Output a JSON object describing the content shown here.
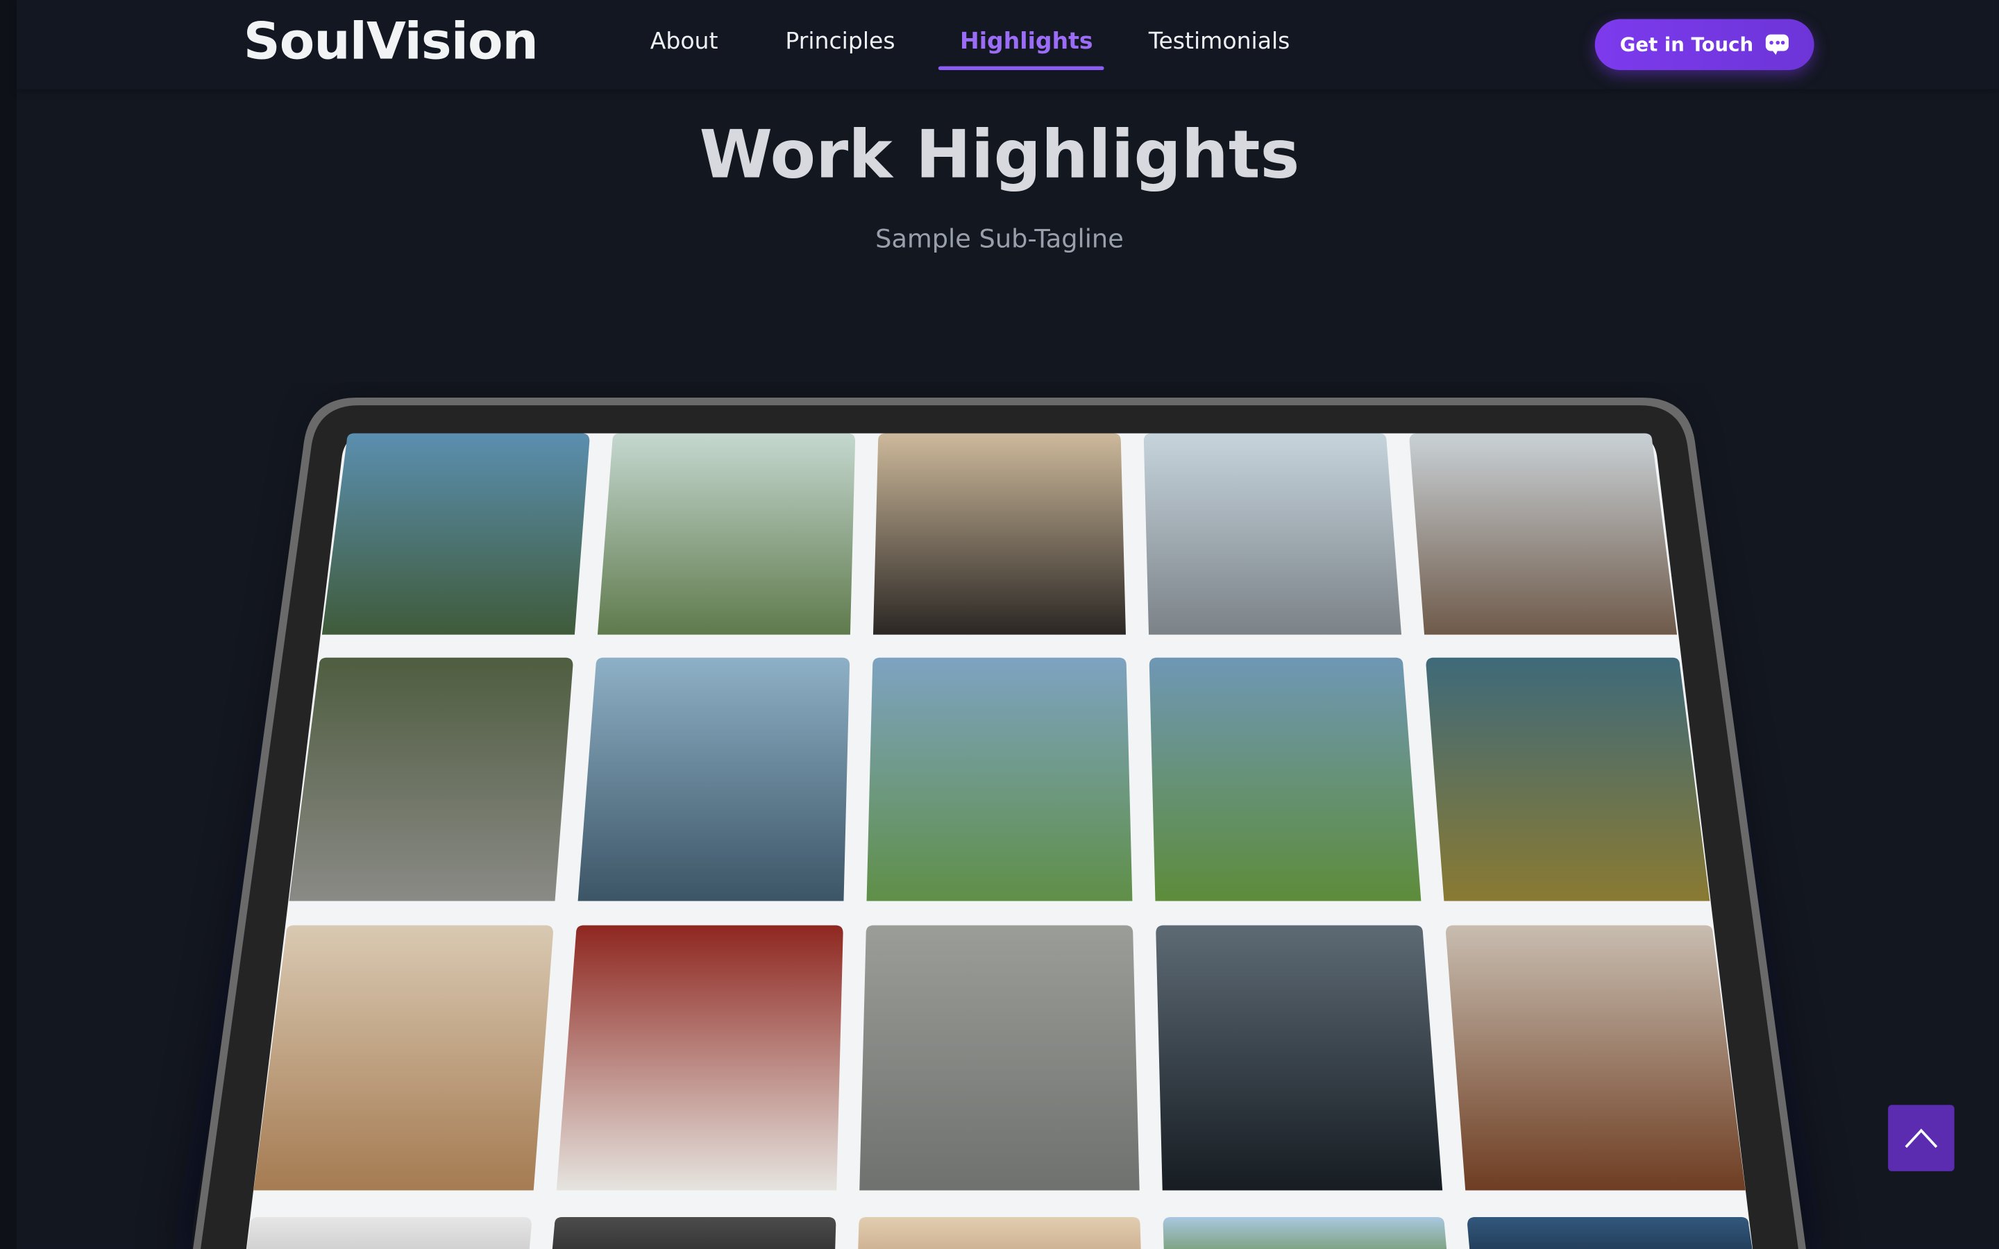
{
  "header": {
    "brand": "SoulVision",
    "nav": [
      {
        "label": "About"
      },
      {
        "label": "Principles"
      },
      {
        "label": "Highlights",
        "active": true
      },
      {
        "label": "Testimonials"
      }
    ],
    "cta_label": "Get in Touch",
    "cta_icon": "chat-bubble-icon"
  },
  "hero": {
    "title": "Work Highlights",
    "subtitle": "Sample Sub-Tagline"
  },
  "gallery": {
    "rows": [
      [
        {
          "subject": "forest-sea",
          "colors": [
            "#5b8fb0",
            "#3f5b3a"
          ]
        },
        {
          "subject": "river-valley",
          "colors": [
            "#c5d8d0",
            "#5f7a4c"
          ]
        },
        {
          "subject": "beach-rocks",
          "colors": [
            "#cdb99b",
            "#2b2724"
          ]
        },
        {
          "subject": "pebble-shore",
          "colors": [
            "#c6d4dc",
            "#7b8288"
          ]
        },
        {
          "subject": "rocky-coast",
          "colors": [
            "#c9d1d6",
            "#6f5a4a"
          ]
        }
      ],
      [
        {
          "subject": "waterfall",
          "colors": [
            "#4f5d40",
            "#8a8a86"
          ]
        },
        {
          "subject": "lake-shore",
          "colors": [
            "#8eb0c6",
            "#3c5566"
          ]
        },
        {
          "subject": "forest-path",
          "colors": [
            "#7ea3c2",
            "#5f8f47"
          ]
        },
        {
          "subject": "meadow-grass",
          "colors": [
            "#6f97b5",
            "#5d8c3a"
          ]
        },
        {
          "subject": "mossy-branch",
          "colors": [
            "#3e6a7a",
            "#8a7a32"
          ]
        }
      ],
      [
        {
          "subject": "desk-workspace",
          "colors": [
            "#d9c9b2",
            "#a57b52"
          ]
        },
        {
          "subject": "white-heels",
          "colors": [
            "#8e2720",
            "#e6e4df"
          ]
        },
        {
          "subject": "man-on-road",
          "colors": [
            "#9b9d99",
            "#6f716e"
          ]
        },
        {
          "subject": "forks",
          "colors": [
            "#5d6a74",
            "#161c22"
          ]
        },
        {
          "subject": "open-book",
          "colors": [
            "#c8bdb0",
            "#6e3d22"
          ]
        }
      ],
      [
        {
          "subject": "partial-1",
          "colors": [
            "#e6e6e6",
            "#c9c9c9"
          ]
        },
        {
          "subject": "partial-2",
          "colors": [
            "#4c4c4c",
            "#2e2e2e"
          ]
        },
        {
          "subject": "partial-3",
          "colors": [
            "#e2cdb0",
            "#c8a98a"
          ]
        },
        {
          "subject": "partial-4",
          "colors": [
            "#a9c7e0",
            "#6f9660"
          ]
        },
        {
          "subject": "partial-5",
          "colors": [
            "#32587c",
            "#1e3550"
          ]
        }
      ]
    ]
  },
  "scroll_top_icon": "chevron-up-icon",
  "colors": {
    "accent": "#8b5cf6",
    "background": "#131720",
    "cta": "#7c3aed"
  }
}
